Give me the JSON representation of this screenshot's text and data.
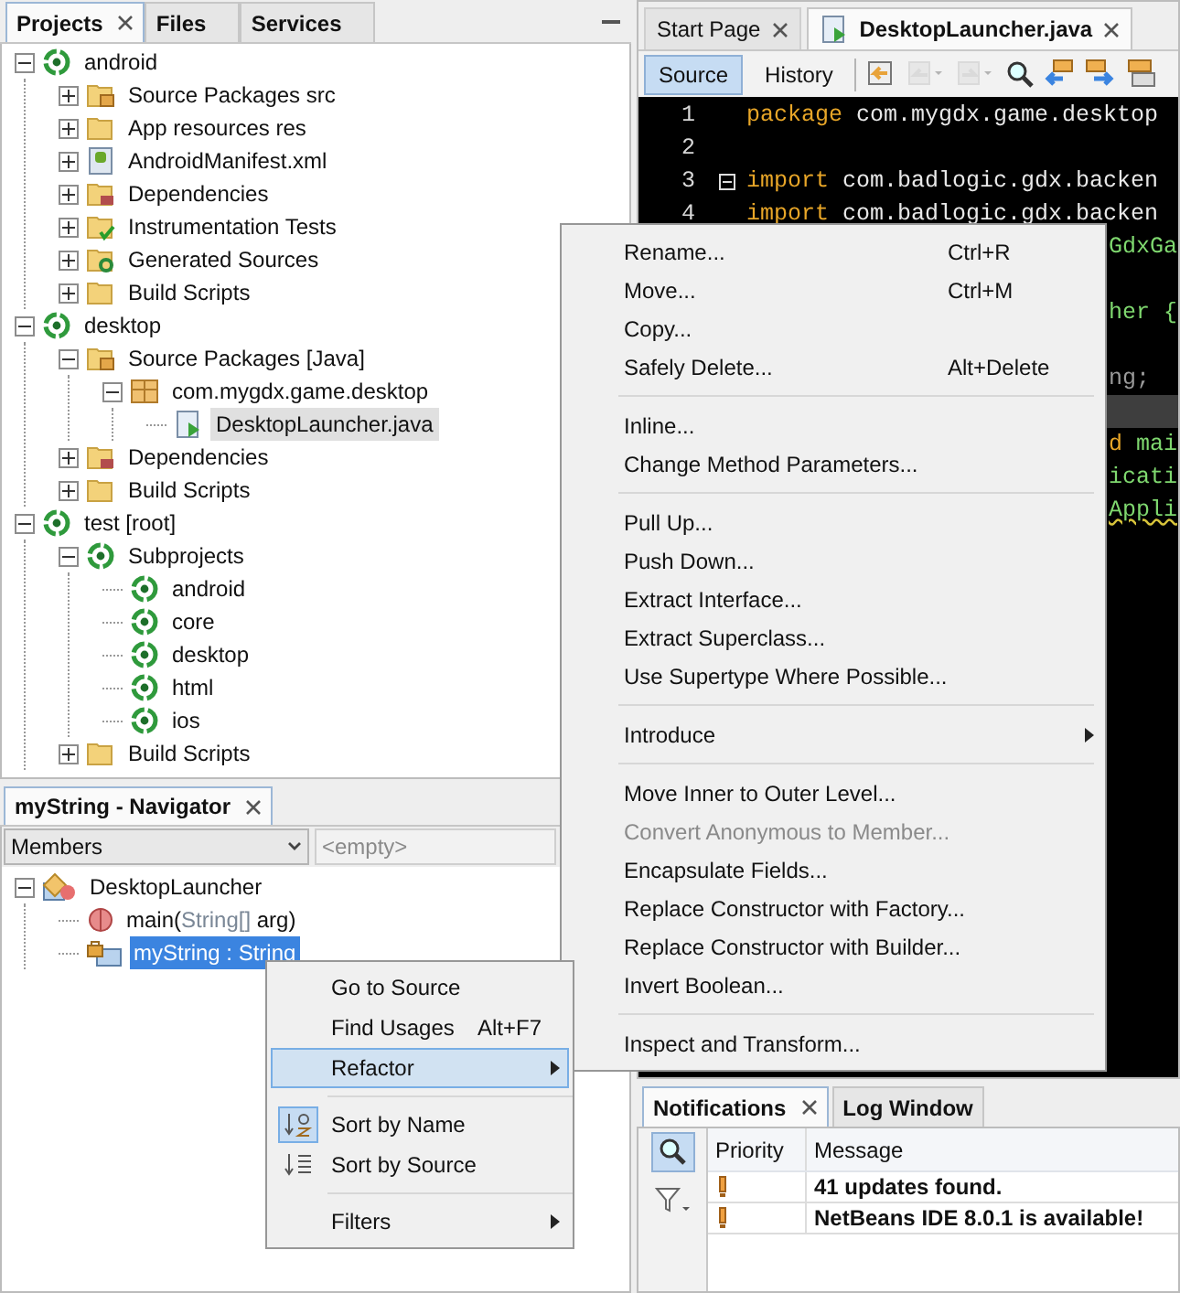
{
  "projects_panel": {
    "tabs": [
      {
        "label": "Projects",
        "selected": true,
        "closable": true
      },
      {
        "label": "Files",
        "selected": false,
        "closable": false
      },
      {
        "label": "Services",
        "selected": false,
        "closable": false
      }
    ],
    "tree": [
      {
        "label": "android",
        "kind": "project",
        "expanded": true,
        "selected": false,
        "children": [
          {
            "label": "Source Packages src",
            "kind": "src-folder",
            "expanded": false,
            "selected": false
          },
          {
            "label": "App resources res",
            "kind": "folder",
            "expanded": false,
            "selected": false
          },
          {
            "label": "AndroidManifest.xml",
            "kind": "android-file",
            "expanded": false,
            "selected": false
          },
          {
            "label": "Dependencies",
            "kind": "deps-folder",
            "expanded": false,
            "selected": false
          },
          {
            "label": "Instrumentation Tests",
            "kind": "tests-folder",
            "expanded": false,
            "selected": false
          },
          {
            "label": "Generated Sources",
            "kind": "generated-folder",
            "expanded": false,
            "selected": false
          },
          {
            "label": "Build Scripts",
            "kind": "folder",
            "expanded": false,
            "selected": false
          }
        ]
      },
      {
        "label": "desktop",
        "kind": "project",
        "expanded": true,
        "selected": false,
        "children": [
          {
            "label": "Source Packages [Java]",
            "kind": "src-folder",
            "expanded": true,
            "selected": false,
            "children": [
              {
                "label": "com.mygdx.game.desktop",
                "kind": "package",
                "expanded": true,
                "selected": false,
                "children": [
                  {
                    "label": "DesktopLauncher.java",
                    "kind": "java-file",
                    "selected": true
                  }
                ]
              }
            ]
          },
          {
            "label": "Dependencies",
            "kind": "deps-folder",
            "expanded": false,
            "selected": false
          },
          {
            "label": "Build Scripts",
            "kind": "folder",
            "expanded": false,
            "selected": false
          }
        ]
      },
      {
        "label": "test [root]",
        "kind": "project",
        "expanded": true,
        "selected": false,
        "children": [
          {
            "label": "Subprojects",
            "kind": "project",
            "expanded": true,
            "selected": false,
            "children": [
              {
                "label": "android",
                "kind": "project",
                "selected": false
              },
              {
                "label": "core",
                "kind": "project",
                "selected": false
              },
              {
                "label": "desktop",
                "kind": "project",
                "selected": false
              },
              {
                "label": "html",
                "kind": "project",
                "selected": false
              },
              {
                "label": "ios",
                "kind": "project",
                "selected": false
              }
            ]
          },
          {
            "label": "Build Scripts",
            "kind": "folder",
            "expanded": false,
            "selected": false
          }
        ]
      }
    ]
  },
  "navigator": {
    "title": "myString - Navigator",
    "filter": {
      "value": "Members"
    },
    "second_filter": {
      "value": "<empty>",
      "disabled": true
    },
    "tree": [
      {
        "kind": "class",
        "expanded": true,
        "selected": false,
        "parts": [
          {
            "text": "DesktopLauncher",
            "muted": false
          }
        ],
        "children": [
          {
            "kind": "method",
            "selected": false,
            "parts": [
              {
                "text": "main(",
                "muted": false
              },
              {
                "text": "String[]",
                "muted": true
              },
              {
                "text": " arg)",
                "muted": false
              }
            ]
          },
          {
            "kind": "field",
            "selected": true,
            "parts": [
              {
                "text": "myString : String",
                "muted": false
              }
            ]
          }
        ]
      }
    ]
  },
  "editor": {
    "tabs": [
      {
        "label": "Start Page",
        "selected": false
      },
      {
        "label": "DesktopLauncher.java",
        "selected": true
      }
    ],
    "views": [
      {
        "label": "Source",
        "selected": true
      },
      {
        "label": "History",
        "selected": false
      }
    ],
    "toolbar": [
      {
        "kind": "last-edit",
        "disabled": false
      },
      {
        "kind": "back",
        "disabled": true
      },
      {
        "kind": "forward",
        "disabled": true
      },
      {
        "kind": "find",
        "disabled": false
      },
      {
        "kind": "prev",
        "disabled": false
      },
      {
        "kind": "next",
        "disabled": false
      },
      {
        "kind": "toggle",
        "disabled": false
      }
    ],
    "lines": [
      {
        "number": "1",
        "kind": "full",
        "fold": false,
        "current": false,
        "segments": [
          {
            "text": "package",
            "kind": "keyword"
          },
          {
            "text": " com.mygdx.game.desktop",
            "kind": "plain"
          }
        ]
      },
      {
        "number": "2",
        "kind": "full",
        "fold": false,
        "current": false
      },
      {
        "number": "3",
        "kind": "full",
        "fold": true,
        "current": false,
        "segments": [
          {
            "text": "import",
            "kind": "keyword"
          },
          {
            "text": " com.badlogic.gdx.backen",
            "kind": "plain"
          }
        ]
      },
      {
        "number": "4",
        "kind": "full",
        "fold": false,
        "current": false,
        "segments": [
          {
            "text": "import",
            "kind": "keyword"
          },
          {
            "text": " com.badlogic.gdx.backen",
            "kind": "plain"
          }
        ]
      },
      {
        "kind": "partial",
        "current": false,
        "segments": [
          {
            "text": "GdxGa",
            "kind": "name"
          }
        ]
      },
      {
        "kind": "partial",
        "current": false
      },
      {
        "kind": "partial",
        "current": false,
        "segments": [
          {
            "text": "her {",
            "kind": "name"
          }
        ]
      },
      {
        "kind": "partial",
        "current": false
      },
      {
        "kind": "partial",
        "current": false,
        "segments": [
          {
            "text": "ng;",
            "kind": "comment"
          }
        ]
      },
      {
        "kind": "partial",
        "current": true
      },
      {
        "kind": "partial",
        "current": false,
        "segments": [
          {
            "text": "d",
            "kind": "keyword"
          },
          {
            "text": " mai",
            "kind": "name"
          }
        ]
      },
      {
        "kind": "partial",
        "current": false,
        "segments": [
          {
            "text": "icati",
            "kind": "name"
          }
        ]
      },
      {
        "kind": "partial",
        "current": false,
        "segments": [
          {
            "text": "Appli",
            "kind": "warning"
          }
        ]
      }
    ]
  },
  "output": {
    "tabs": [
      {
        "label": "Notifications",
        "selected": true,
        "closable": true
      },
      {
        "label": "Log Window",
        "selected": false,
        "closable": false
      }
    ],
    "tools": [
      {
        "kind": "search",
        "on": true
      },
      {
        "kind": "filter",
        "on": false
      }
    ],
    "columns": [
      "Priority",
      "Message"
    ],
    "rows": [
      {
        "message": "41 updates found."
      },
      {
        "message": "NetBeans IDE 8.0.1 is available!"
      }
    ]
  },
  "navigator_menu": {
    "items": [
      {
        "kind": "item",
        "label": "Go to Source",
        "selected": false
      },
      {
        "kind": "item",
        "label": "Find Usages",
        "shortcut": "Alt+F7",
        "selected": false
      },
      {
        "kind": "item",
        "label": "Refactor",
        "submenu": true,
        "selected": true
      },
      {
        "kind": "separator"
      },
      {
        "kind": "toggle",
        "label": "Sort by Name",
        "checked": true,
        "selected": false
      },
      {
        "kind": "toggle",
        "label": "Sort by Source",
        "checked": false,
        "selected": false
      },
      {
        "kind": "separator"
      },
      {
        "kind": "item",
        "label": "Filters",
        "submenu": true,
        "selected": false
      }
    ]
  },
  "refactor_menu": {
    "items": [
      {
        "kind": "item",
        "label": "Rename...",
        "shortcut": "Ctrl+R",
        "disabled": false
      },
      {
        "kind": "item",
        "label": "Move...",
        "shortcut": "Ctrl+M",
        "disabled": false
      },
      {
        "kind": "item",
        "label": "Copy...",
        "disabled": false
      },
      {
        "kind": "item",
        "label": "Safely Delete...",
        "shortcut": "Alt+Delete",
        "disabled": false
      },
      {
        "kind": "separator"
      },
      {
        "kind": "item",
        "label": "Inline...",
        "disabled": false
      },
      {
        "kind": "item",
        "label": "Change Method Parameters...",
        "disabled": false
      },
      {
        "kind": "separator"
      },
      {
        "kind": "item",
        "label": "Pull Up...",
        "disabled": false
      },
      {
        "kind": "item",
        "label": "Push Down...",
        "disabled": false
      },
      {
        "kind": "item",
        "label": "Extract Interface...",
        "disabled": false
      },
      {
        "kind": "item",
        "label": "Extract Superclass...",
        "disabled": false
      },
      {
        "kind": "item",
        "label": "Use Supertype Where Possible...",
        "disabled": false
      },
      {
        "kind": "separator"
      },
      {
        "kind": "item",
        "label": "Introduce",
        "submenu": true,
        "disabled": false
      },
      {
        "kind": "separator"
      },
      {
        "kind": "item",
        "label": "Move Inner to Outer Level...",
        "disabled": false
      },
      {
        "kind": "item",
        "label": "Convert Anonymous to Member...",
        "disabled": true
      },
      {
        "kind": "item",
        "label": "Encapsulate Fields...",
        "disabled": false
      },
      {
        "kind": "item",
        "label": "Replace Constructor with Factory...",
        "disabled": false
      },
      {
        "kind": "item",
        "label": "Replace Constructor with Builder...",
        "disabled": false
      },
      {
        "kind": "item",
        "label": "Invert Boolean...",
        "disabled": false
      },
      {
        "kind": "separator"
      },
      {
        "kind": "item",
        "label": "Inspect and Transform...",
        "disabled": false
      }
    ]
  }
}
